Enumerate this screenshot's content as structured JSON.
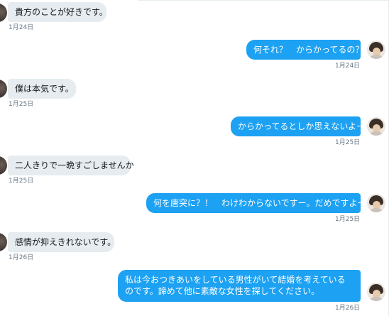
{
  "conversation": {
    "messages": [
      {
        "direction": "received",
        "text": "貴方のことが好きです。",
        "date": "1月24日"
      },
      {
        "direction": "sent",
        "text": "何それ？　からかってるの？",
        "date": "1月24日"
      },
      {
        "direction": "received",
        "text": "僕は本気です。",
        "date": "1月25日"
      },
      {
        "direction": "sent",
        "text": "からかってるとしか思えないよー",
        "date": "1月25日"
      },
      {
        "direction": "received",
        "text": "二人きりで一晩すごしませんか",
        "date": "1月25日"
      },
      {
        "direction": "sent",
        "text": "何を唐突に？！　わけわからないですー。だめですよー。",
        "date": "1月25日"
      },
      {
        "direction": "received",
        "text": "感情が抑えきれないです。",
        "date": "1月26日"
      },
      {
        "direction": "sent",
        "text": "私は今おつきあいをしている男性がいて結婚を考えているのです。諦めて他に素敵な女性を探してください。",
        "date": "1月26日"
      }
    ]
  },
  "colors": {
    "sent_bubble": "#1da1f2",
    "received_bubble": "#e6ecf0",
    "timestamp": "#657786"
  }
}
